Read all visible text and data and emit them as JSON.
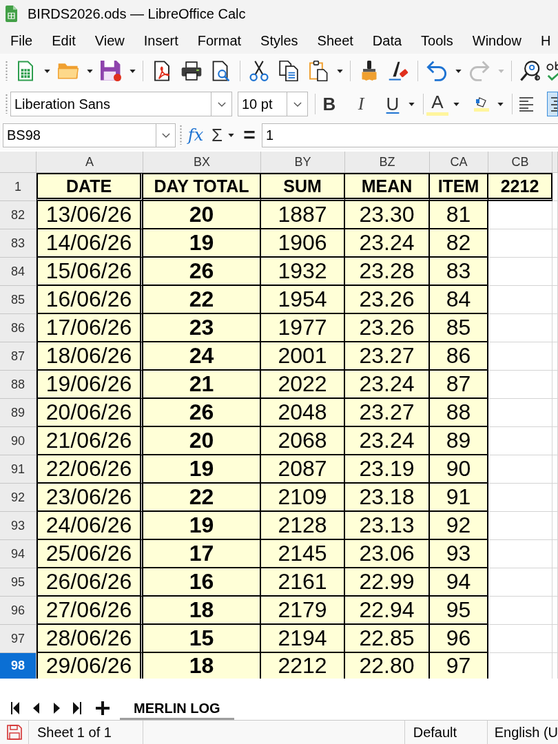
{
  "window": {
    "title": "BIRDS2026.ods — LibreOffice Calc"
  },
  "menu": [
    "File",
    "Edit",
    "View",
    "Insert",
    "Format",
    "Styles",
    "Sheet",
    "Data",
    "Tools",
    "Window",
    "H"
  ],
  "standard_toolbar": [
    {
      "buttons": [
        {
          "kind": "new",
          "dropdown": true,
          "disabled": false
        },
        {
          "kind": "open",
          "dropdown": true,
          "disabled": false
        },
        {
          "kind": "save",
          "dropdown": true,
          "disabled": false
        }
      ]
    },
    {
      "buttons": [
        {
          "kind": "pdf",
          "dropdown": false,
          "disabled": false
        },
        {
          "kind": "print",
          "dropdown": false,
          "disabled": false
        },
        {
          "kind": "preview",
          "dropdown": false,
          "disabled": false
        }
      ]
    },
    {
      "buttons": [
        {
          "kind": "cut",
          "dropdown": false,
          "disabled": false
        },
        {
          "kind": "copy",
          "dropdown": false,
          "disabled": false
        },
        {
          "kind": "paste",
          "dropdown": true,
          "disabled": false
        }
      ]
    },
    {
      "buttons": [
        {
          "kind": "clone",
          "dropdown": false,
          "disabled": false
        },
        {
          "kind": "clear",
          "dropdown": false,
          "disabled": false
        }
      ]
    },
    {
      "buttons": [
        {
          "kind": "undo",
          "dropdown": true,
          "disabled": false
        },
        {
          "kind": "redo",
          "dropdown": true,
          "disabled": true
        }
      ]
    },
    {
      "buttons": [
        {
          "kind": "find",
          "dropdown": false,
          "disabled": false
        },
        {
          "kind": "spelling",
          "dropdown": false,
          "disabled": false
        }
      ]
    }
  ],
  "formatting_toolbar": {
    "font_name": "Liberation Sans",
    "font_size": "10 pt",
    "groups": [
      {
        "buttons": [
          {
            "kind": "bold",
            "label": "B",
            "dropdown": false,
            "selected": false
          },
          {
            "kind": "italic",
            "label": "I",
            "dropdown": false,
            "selected": false
          },
          {
            "kind": "underline",
            "label": "U",
            "dropdown": true,
            "selected": false
          }
        ]
      },
      {
        "buttons": [
          {
            "kind": "font-color",
            "label": "A",
            "dropdown": true,
            "selected": false
          },
          {
            "kind": "highlight",
            "dropdown": true,
            "selected": false
          }
        ]
      },
      {
        "buttons": [
          {
            "kind": "align-left",
            "dropdown": false,
            "selected": false
          },
          {
            "kind": "align-center",
            "dropdown": false,
            "selected": true
          }
        ]
      }
    ]
  },
  "formula_bar": {
    "name_box": "BS98",
    "function_wizard": "fx",
    "sum": "Σ",
    "formula": "=",
    "input": "1"
  },
  "sheet": {
    "columns": [
      {
        "label": "A",
        "kind": "plain"
      },
      {
        "label": "BX",
        "kind": "bold"
      },
      {
        "label": "BY",
        "kind": "plain"
      },
      {
        "label": "BZ",
        "kind": "plain"
      },
      {
        "label": "CA",
        "kind": "plain"
      },
      {
        "label": "CB",
        "kind": "plain"
      }
    ],
    "header_row": {
      "number": "1",
      "cells": [
        "DATE",
        "DAY TOTAL",
        "SUM",
        "MEAN",
        "ITEM",
        "2212"
      ]
    },
    "rows": [
      {
        "number": "82",
        "selected": false,
        "cells": [
          "13/06/26",
          "20",
          "1887",
          "23.30",
          "81"
        ]
      },
      {
        "number": "83",
        "selected": false,
        "cells": [
          "14/06/26",
          "19",
          "1906",
          "23.24",
          "82"
        ]
      },
      {
        "number": "84",
        "selected": false,
        "cells": [
          "15/06/26",
          "26",
          "1932",
          "23.28",
          "83"
        ]
      },
      {
        "number": "85",
        "selected": false,
        "cells": [
          "16/06/26",
          "22",
          "1954",
          "23.26",
          "84"
        ]
      },
      {
        "number": "86",
        "selected": false,
        "cells": [
          "17/06/26",
          "23",
          "1977",
          "23.26",
          "85"
        ]
      },
      {
        "number": "87",
        "selected": false,
        "cells": [
          "18/06/26",
          "24",
          "2001",
          "23.27",
          "86"
        ]
      },
      {
        "number": "88",
        "selected": false,
        "cells": [
          "19/06/26",
          "21",
          "2022",
          "23.24",
          "87"
        ]
      },
      {
        "number": "89",
        "selected": false,
        "cells": [
          "20/06/26",
          "26",
          "2048",
          "23.27",
          "88"
        ]
      },
      {
        "number": "90",
        "selected": false,
        "cells": [
          "21/06/26",
          "20",
          "2068",
          "23.24",
          "89"
        ]
      },
      {
        "number": "91",
        "selected": false,
        "cells": [
          "22/06/26",
          "19",
          "2087",
          "23.19",
          "90"
        ]
      },
      {
        "number": "92",
        "selected": false,
        "cells": [
          "23/06/26",
          "22",
          "2109",
          "23.18",
          "91"
        ]
      },
      {
        "number": "93",
        "selected": false,
        "cells": [
          "24/06/26",
          "19",
          "2128",
          "23.13",
          "92"
        ]
      },
      {
        "number": "94",
        "selected": false,
        "cells": [
          "25/06/26",
          "17",
          "2145",
          "23.06",
          "93"
        ]
      },
      {
        "number": "95",
        "selected": false,
        "cells": [
          "26/06/26",
          "16",
          "2161",
          "22.99",
          "94"
        ]
      },
      {
        "number": "96",
        "selected": false,
        "cells": [
          "27/06/26",
          "18",
          "2179",
          "22.94",
          "95"
        ]
      },
      {
        "number": "97",
        "selected": false,
        "cells": [
          "28/06/26",
          "15",
          "2194",
          "22.85",
          "96"
        ]
      },
      {
        "number": "98",
        "selected": true,
        "cells": [
          "29/06/26",
          "18",
          "2212",
          "22.80",
          "97"
        ]
      }
    ]
  },
  "sheet_tabs": [
    {
      "label": "MERLIN LOG",
      "selected": true
    }
  ],
  "status_bar": {
    "sheet": "Sheet 1 of 1",
    "page_style": "Default",
    "language": "English (U"
  }
}
